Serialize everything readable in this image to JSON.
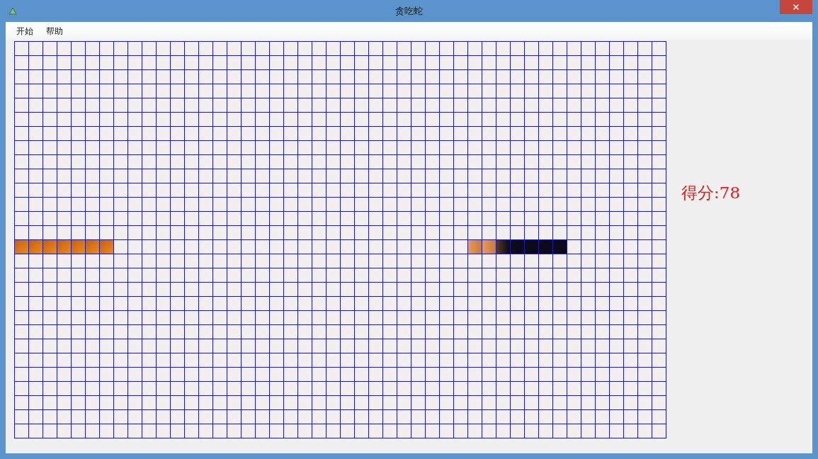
{
  "window": {
    "title": "贪吃蛇"
  },
  "menu": [
    {
      "label": "开始"
    },
    {
      "label": "帮助"
    }
  ],
  "board": {
    "rows": [
      {
        "kind": "empty"
      },
      {
        "kind": "empty"
      },
      {
        "kind": "empty"
      },
      {
        "kind": "empty"
      },
      {
        "kind": "empty"
      },
      {
        "kind": "empty"
      },
      {
        "kind": "empty"
      },
      {
        "kind": "empty"
      },
      {
        "kind": "empty"
      },
      {
        "kind": "empty"
      },
      {
        "kind": "empty"
      },
      {
        "kind": "empty"
      },
      {
        "kind": "empty"
      },
      {
        "kind": "empty"
      },
      {
        "kind": "cells",
        "cells": [
          {
            "kind": "orange"
          },
          {
            "kind": "orange"
          },
          {
            "kind": "orange"
          },
          {
            "kind": "orange"
          },
          {
            "kind": "orange"
          },
          {
            "kind": "orange"
          },
          {
            "kind": "orange"
          },
          {
            "kind": "empty"
          },
          {
            "kind": "empty"
          },
          {
            "kind": "empty"
          },
          {
            "kind": "empty"
          },
          {
            "kind": "empty"
          },
          {
            "kind": "empty"
          },
          {
            "kind": "empty"
          },
          {
            "kind": "empty"
          },
          {
            "kind": "empty"
          },
          {
            "kind": "empty"
          },
          {
            "kind": "empty"
          },
          {
            "kind": "empty"
          },
          {
            "kind": "empty"
          },
          {
            "kind": "empty"
          },
          {
            "kind": "empty"
          },
          {
            "kind": "empty"
          },
          {
            "kind": "empty"
          },
          {
            "kind": "empty"
          },
          {
            "kind": "empty"
          },
          {
            "kind": "empty"
          },
          {
            "kind": "empty"
          },
          {
            "kind": "empty"
          },
          {
            "kind": "empty"
          },
          {
            "kind": "empty"
          },
          {
            "kind": "empty"
          },
          {
            "kind": "peach"
          },
          {
            "kind": "peach"
          },
          {
            "kind": "dusk"
          },
          {
            "kind": "dark"
          },
          {
            "kind": "dark"
          },
          {
            "kind": "dark"
          },
          {
            "kind": "dark"
          }
        ]
      },
      {
        "kind": "empty"
      },
      {
        "kind": "empty"
      },
      {
        "kind": "empty"
      },
      {
        "kind": "empty"
      },
      {
        "kind": "empty"
      },
      {
        "kind": "empty"
      },
      {
        "kind": "empty"
      },
      {
        "kind": "empty"
      },
      {
        "kind": "empty"
      },
      {
        "kind": "empty"
      },
      {
        "kind": "empty"
      },
      {
        "kind": "empty"
      },
      {
        "kind": "empty"
      }
    ]
  },
  "score": "得分:78"
}
